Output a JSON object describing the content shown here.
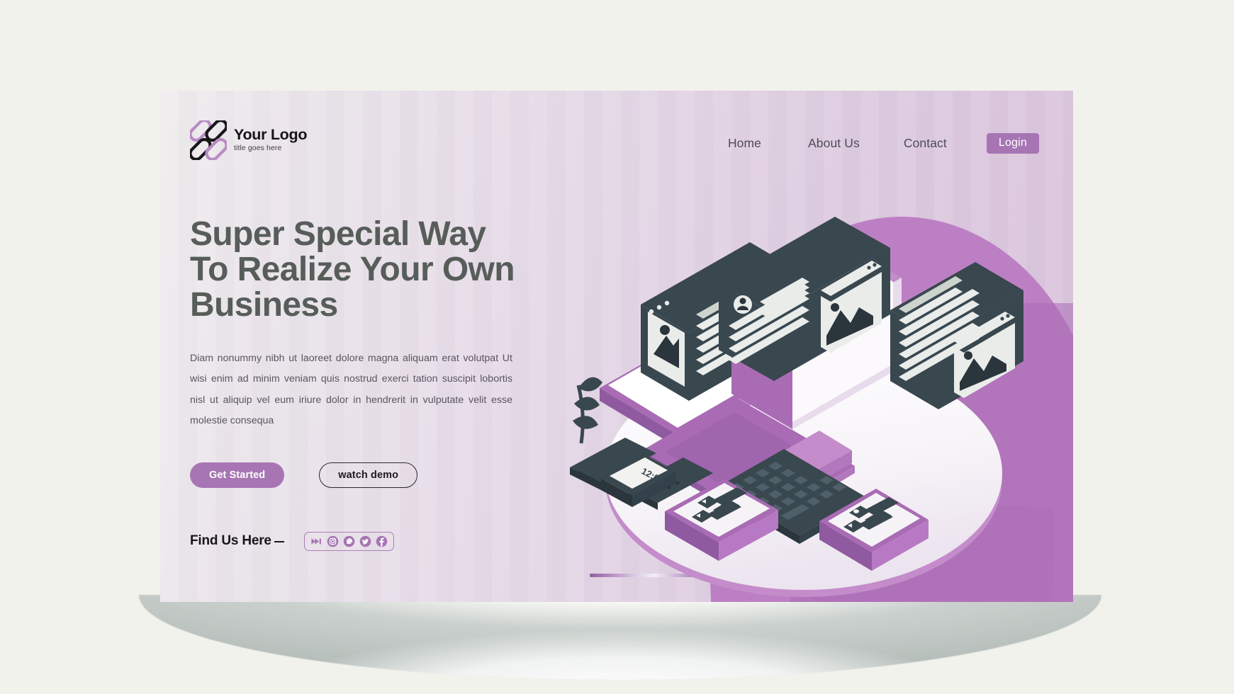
{
  "brand": {
    "logo_icon": "interlocking-loops-logo",
    "name": "Your Logo",
    "tagline": "title goes here"
  },
  "nav": {
    "items": [
      {
        "label": "Home"
      },
      {
        "label": "About Us"
      },
      {
        "label": "Contact"
      }
    ],
    "login_label": "Login"
  },
  "hero": {
    "headline": "Super Special Way\nTo Realize Your Own\nBusiness",
    "paragraph": "Diam nonummy nibh ut laoreet dolore magna aliquam erat volutpat Ut wisi enim ad minim veniam quis nostrud exerci tation suscipit lobortis nisl ut aliquip vel eum iriure dolor in hendrerit in vulputate velit esse molestie consequa",
    "primary_cta": "Get Started",
    "secondary_cta": "watch demo"
  },
  "footer": {
    "find_us_label": "Find Us Here",
    "social": [
      {
        "name": "fast-forward-icon"
      },
      {
        "name": "instagram-icon"
      },
      {
        "name": "whatsapp-icon"
      },
      {
        "name": "twitter-icon"
      },
      {
        "name": "facebook-icon"
      }
    ]
  },
  "illustration": {
    "name": "isometric-workspace-illustration",
    "watch_time": "12:00",
    "devices": [
      "laptop",
      "monitor",
      "keyboard",
      "tablet",
      "smartwatch",
      "notepad",
      "plant"
    ],
    "floating_cards": [
      "article-card",
      "mobile-media-card",
      "profile-card",
      "media-card"
    ]
  },
  "colors": {
    "page_background": "#f2f2ec",
    "hero_gradient_start": "#efecee",
    "hero_gradient_end": "#d9c3dc",
    "accent_purple": "#a775b3",
    "blob_purple": "#bd7fc4",
    "blob_purple_dark": "#a96cb4",
    "headline_gray": "#575d59",
    "body_text": "#5a5560",
    "dark_ink": "#39474f"
  }
}
